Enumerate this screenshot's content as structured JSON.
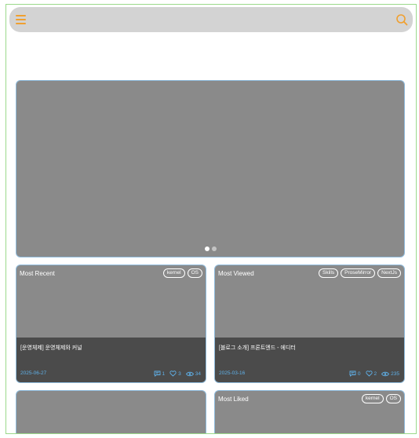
{
  "header": {
    "menu_icon": "hamburger-menu-icon",
    "search_icon": "search-icon",
    "accent_color": "#f0a030"
  },
  "hero": {
    "slide_count": 2,
    "active_slide": 1
  },
  "cards": [
    {
      "label": "Most Recent",
      "tags": [
        "kernel",
        "OS"
      ],
      "title": "[운영체제] 운영체제와 커널",
      "date": "2025-06-27",
      "comments": "1",
      "likes": "3",
      "views": "34"
    },
    {
      "label": "Most Viewed",
      "tags": [
        "Skills",
        "ProseMirror",
        "NextJs"
      ],
      "title": "[블로그 소개] 프론트엔드 - 에디터",
      "date": "2025-03-16",
      "comments": "0",
      "likes": "2",
      "views": "235"
    },
    {
      "label": "",
      "tags": []
    },
    {
      "label": "Most Liked",
      "tags": [
        "kernel",
        "OS"
      ]
    }
  ],
  "colors": {
    "card_bg": "#8a8a8a",
    "card_bottom_bg": "#4b4b4b",
    "meta_text": "#5fb0e8",
    "border": "#8fbbdc"
  }
}
